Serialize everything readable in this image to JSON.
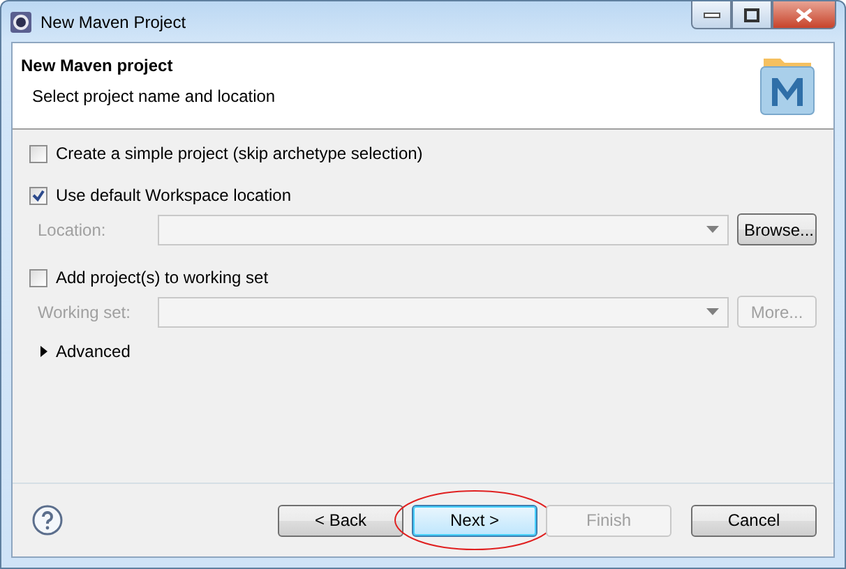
{
  "window": {
    "title": "New Maven Project"
  },
  "header": {
    "title": "New Maven project",
    "subtitle": "Select project name and location"
  },
  "options": [
    {
      "kind": "checkbox",
      "label": "Create a simple project (skip archetype selection)",
      "checked": false
    },
    {
      "kind": "checkbox",
      "label": "Use default Workspace location",
      "checked": true
    },
    {
      "kind": "combo",
      "label": "Location:",
      "disabled": true,
      "button": {
        "label": "Browse...",
        "disabled": false
      }
    },
    {
      "kind": "checkbox",
      "label": "Add project(s) to working set",
      "checked": false
    },
    {
      "kind": "combo",
      "label": "Working set:",
      "disabled": true,
      "button": {
        "label": "More...",
        "disabled": true
      }
    },
    {
      "kind": "expander",
      "label": "Advanced",
      "expanded": false
    }
  ],
  "buttons": [
    {
      "label": "< Back",
      "disabled": false,
      "circled": false
    },
    {
      "label": "Next >",
      "disabled": false,
      "circled": true
    },
    {
      "label": "Finish",
      "disabled": true,
      "circled": false
    },
    {
      "label": "Cancel",
      "disabled": false,
      "circled": false
    }
  ]
}
